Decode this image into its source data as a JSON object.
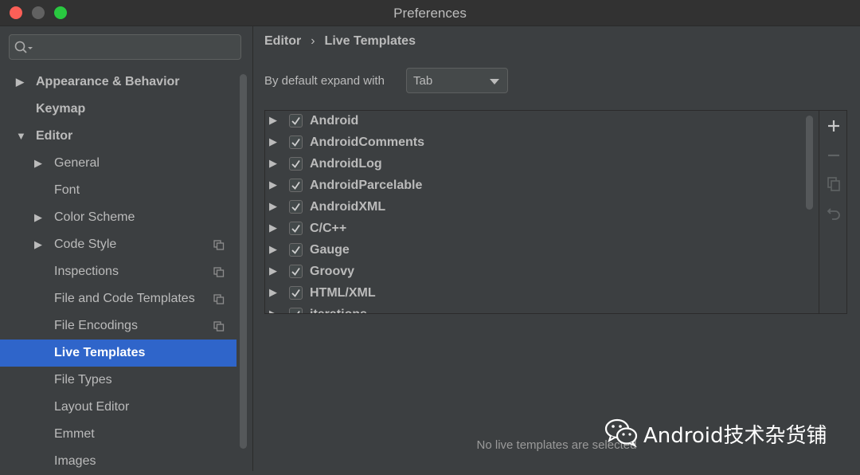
{
  "window": {
    "title": "Preferences"
  },
  "search": {
    "placeholder": ""
  },
  "sidebar": {
    "items": [
      {
        "label": "Appearance & Behavior",
        "level": 0,
        "arrow": "▶",
        "bold": true
      },
      {
        "label": "Keymap",
        "level": 0,
        "arrow": "",
        "bold": true
      },
      {
        "label": "Editor",
        "level": 0,
        "arrow": "▼",
        "bold": true
      },
      {
        "label": "General",
        "level": 1,
        "arrow": "▶"
      },
      {
        "label": "Font",
        "level": 1,
        "arrow": ""
      },
      {
        "label": "Color Scheme",
        "level": 1,
        "arrow": "▶"
      },
      {
        "label": "Code Style",
        "level": 1,
        "arrow": "▶",
        "icon": "project-copy-icon"
      },
      {
        "label": "Inspections",
        "level": 1,
        "arrow": "",
        "icon": "project-copy-icon"
      },
      {
        "label": "File and Code Templates",
        "level": 1,
        "arrow": "",
        "icon": "project-copy-icon"
      },
      {
        "label": "File Encodings",
        "level": 1,
        "arrow": "",
        "icon": "project-copy-icon"
      },
      {
        "label": "Live Templates",
        "level": 1,
        "arrow": "",
        "selected": true
      },
      {
        "label": "File Types",
        "level": 1,
        "arrow": ""
      },
      {
        "label": "Layout Editor",
        "level": 1,
        "arrow": ""
      },
      {
        "label": "Emmet",
        "level": 1,
        "arrow": ""
      },
      {
        "label": "Images",
        "level": 1,
        "arrow": ""
      }
    ]
  },
  "breadcrumb": {
    "parent": "Editor",
    "separator": "›",
    "current": "Live Templates"
  },
  "expand": {
    "label": "By default expand with",
    "value": "Tab"
  },
  "templates": [
    {
      "name": "Android",
      "checked": true
    },
    {
      "name": "AndroidComments",
      "checked": true
    },
    {
      "name": "AndroidLog",
      "checked": true
    },
    {
      "name": "AndroidParcelable",
      "checked": true
    },
    {
      "name": "AndroidXML",
      "checked": true
    },
    {
      "name": "C/C++",
      "checked": true
    },
    {
      "name": "Gauge",
      "checked": true
    },
    {
      "name": "Groovy",
      "checked": true
    },
    {
      "name": "HTML/XML",
      "checked": true
    },
    {
      "name": "iterations",
      "checked": true
    }
  ],
  "toolbar": {
    "icons": [
      "add-icon",
      "remove-icon",
      "copy-icon",
      "revert-icon"
    ]
  },
  "empty_message": "No live templates are selected",
  "watermark": {
    "text": "Android技术杂货铺"
  },
  "colors": {
    "selection": "#2f65ca",
    "background": "#3c3f41",
    "text": "#bbbbbb"
  }
}
